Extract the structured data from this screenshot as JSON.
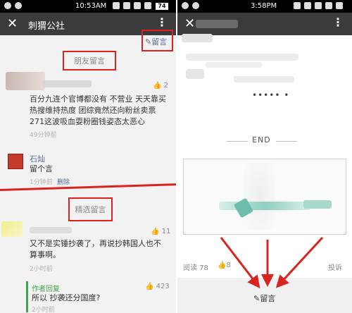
{
  "left": {
    "status": {
      "time": "10:53AM",
      "battery": "74"
    },
    "title": "刺猬公社",
    "write_label": "留言",
    "friends_label": "朋友留言",
    "comment1": {
      "likes": "2",
      "lines": [
        "百分九连个官博都没有 不营业 天天靠买",
        "热搜维持热度 团综竟然还向粉丝卖票",
        "271这波吸血耍粉圈钱姿态太恶心"
      ],
      "time": "49分钟前"
    },
    "comment2": {
      "name": "石灿",
      "text": "留个言",
      "time": "1分钟前",
      "delete_label": "删除"
    },
    "featured_label": "精选留言",
    "comment3": {
      "likes": "11",
      "lines": [
        "又不是实锤抄袭了，再说抄韩国人也不",
        "算事啊。"
      ],
      "time": "2小时前"
    },
    "reply": {
      "label": "作者回复",
      "likes": "423",
      "text": "所以 抄袭还分国度?",
      "time": "2小时前"
    }
  },
  "right": {
    "status": {
      "time": "3:58PM"
    },
    "dots": "••••• •",
    "end_label": "END",
    "read_label": "阅读",
    "read_count": "78",
    "like_count": "8",
    "report_label": "投诉",
    "write_label": "留言"
  },
  "colors": {
    "red_highlight": "#d9231f",
    "link_blue": "#576b95",
    "reply_green": "#3ea34a",
    "titlebar": "#3b3b3b"
  }
}
